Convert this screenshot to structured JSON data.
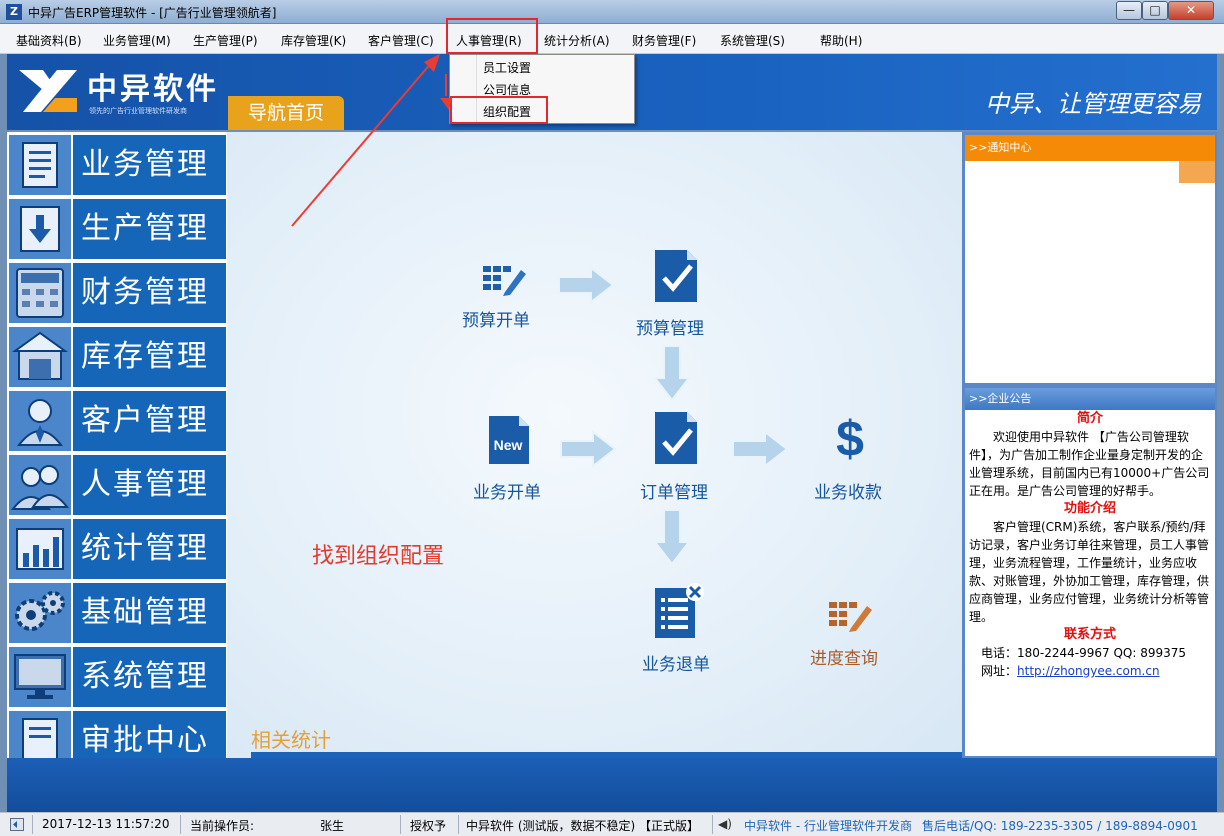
{
  "window": {
    "title": "中异广告ERP管理软件 - [广告行业管理领航者]",
    "minimize": "—",
    "maximize": "□",
    "close": "✕"
  },
  "menu": [
    "基础资料(B)",
    "业务管理(M)",
    "生产管理(P)",
    "库存管理(K)",
    "客户管理(C)",
    "人事管理(R)",
    "统计分析(A)",
    "财务管理(F)",
    "系统管理(S)",
    "帮助(H)"
  ],
  "dropdown": [
    "员工设置",
    "公司信息",
    "组织配置"
  ],
  "banner": {
    "logo_text": "中异软件",
    "logo_sub": "领先的广告行业管理软件研发商",
    "slogan": "中异、让管理更容易",
    "nav_tab": "导航首页"
  },
  "left_nav": [
    "业务管理",
    "生产管理",
    "财务管理",
    "库存管理",
    "客户管理",
    "人事管理",
    "统计管理",
    "基础管理",
    "系统管理",
    "审批中心"
  ],
  "left_nav_icons": [
    "document-icon",
    "download-doc-icon",
    "calculator-icon",
    "warehouse-icon",
    "customer-icon",
    "people-icon",
    "chart-icon",
    "gears-icon",
    "monitor-icon",
    "approval-icon"
  ],
  "flow": {
    "budget_open": "预算开单",
    "budget_manage": "预算管理",
    "business_open": "业务开单",
    "order_manage": "订单管理",
    "business_collect": "业务收款",
    "business_return": "业务退单",
    "progress_query": "进度查询",
    "new_badge": "New"
  },
  "annotation": "找到组织配置",
  "related_stats": "相关统计",
  "right_panel": {
    "notify_title": ">>通知中心",
    "notice_title": ">>企业公告",
    "intro_title": "简介",
    "intro_text": "欢迎使用中异软件 【广告公司管理软件】，为广告加工制作企业量身定制开发的企业管理系统，目前国内已有10000+广告公司正在用。是广告公司管理的好帮手。",
    "features_title": "功能介绍",
    "features_text": "客户管理(CRM)系统，客户联系/预约/拜访记录，客户业务订单往来管理，员工人事管理，业务流程管理，工作量统计，业务应收款、对账管理，外协加工管理，库存管理，供应商管理，业务应付管理，业务统计分析等管理。",
    "contact_title": "联系方式",
    "phone": "电话：180-2244-9967  QQ: 899375",
    "website_label": "网址：",
    "website": "http://zhongyee.com.cn"
  },
  "status": {
    "datetime": "2017-12-13 11:57:20",
    "operator_label": "当前操作员:",
    "operator": "张生",
    "auth": "授权予",
    "edition": "中异软件 (测试版，数据不稳定) 【正式版】",
    "company": "中异软件 - 行业管理软件开发商",
    "hotline": "售后电话/QQ: 189-2235-3305 / 189-8894-0901"
  },
  "colors": {
    "banner_blue": "#1552a8",
    "nav_blue": "#1566b8",
    "orange": "#f58a06",
    "annotation_red": "#e23a2e",
    "flow_text": "#16569e"
  }
}
